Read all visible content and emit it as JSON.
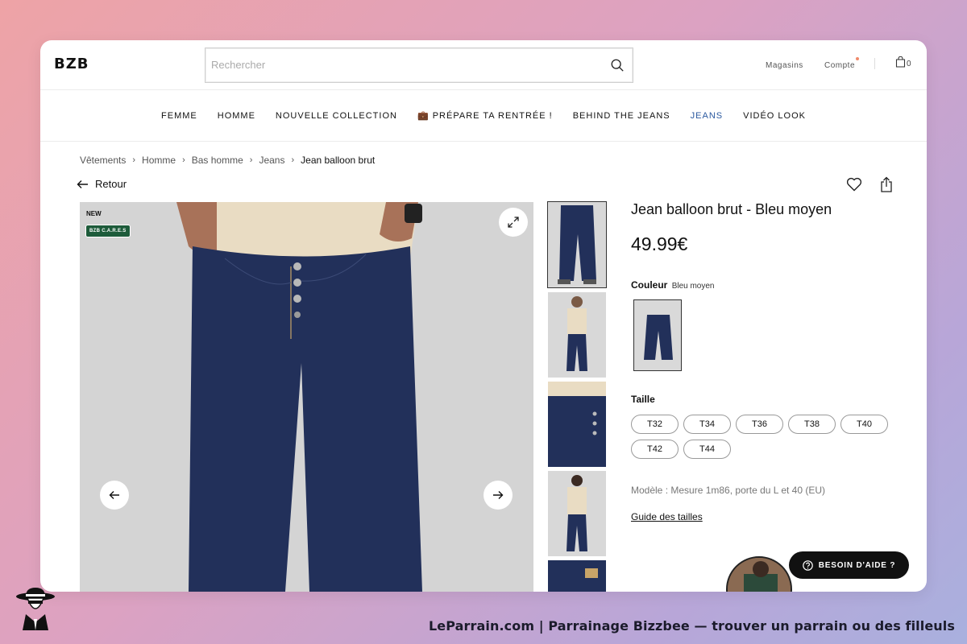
{
  "header": {
    "logo": "BZB",
    "search_placeholder": "Rechercher",
    "stores_label": "Magasins",
    "account_label": "Compte",
    "cart_count": "0"
  },
  "nav": {
    "items": [
      {
        "label": "FEMME"
      },
      {
        "label": "HOMME"
      },
      {
        "label": "NOUVELLE COLLECTION"
      },
      {
        "label": "💼 PRÉPARE TA RENTRÉE !"
      },
      {
        "label": "BEHIND THE JEANS"
      },
      {
        "label": "JEANS",
        "active": true
      },
      {
        "label": "VIDÉO LOOK"
      }
    ]
  },
  "breadcrumb": [
    "Vêtements",
    "Homme",
    "Bas homme",
    "Jeans",
    "Jean balloon brut"
  ],
  "back_label": "Retour",
  "gallery": {
    "badge_new": "NEW",
    "badge_cares": "BZB C.A.R.E.S"
  },
  "product": {
    "title": "Jean balloon brut - Bleu moyen",
    "price": "49.99€",
    "color_label": "Couleur",
    "color_value": "Bleu moyen",
    "size_label": "Taille",
    "sizes": [
      "T32",
      "T34",
      "T36",
      "T38",
      "T40",
      "T42",
      "T44"
    ],
    "model_info": "Modèle : Mesure 1m86, porte du L et 40 (EU)",
    "size_guide": "Guide des tailles"
  },
  "help_label": "BESOIN D'AIDE ?",
  "footer_text": "LeParrain.com | Parrainage Bizzbee — trouver un parrain ou des filleuls",
  "colors": {
    "denim": "#22305a",
    "accent_nav": "#2c5aa0",
    "cares_green": "#1d5b3a",
    "notification_dot": "#f08a6a"
  }
}
